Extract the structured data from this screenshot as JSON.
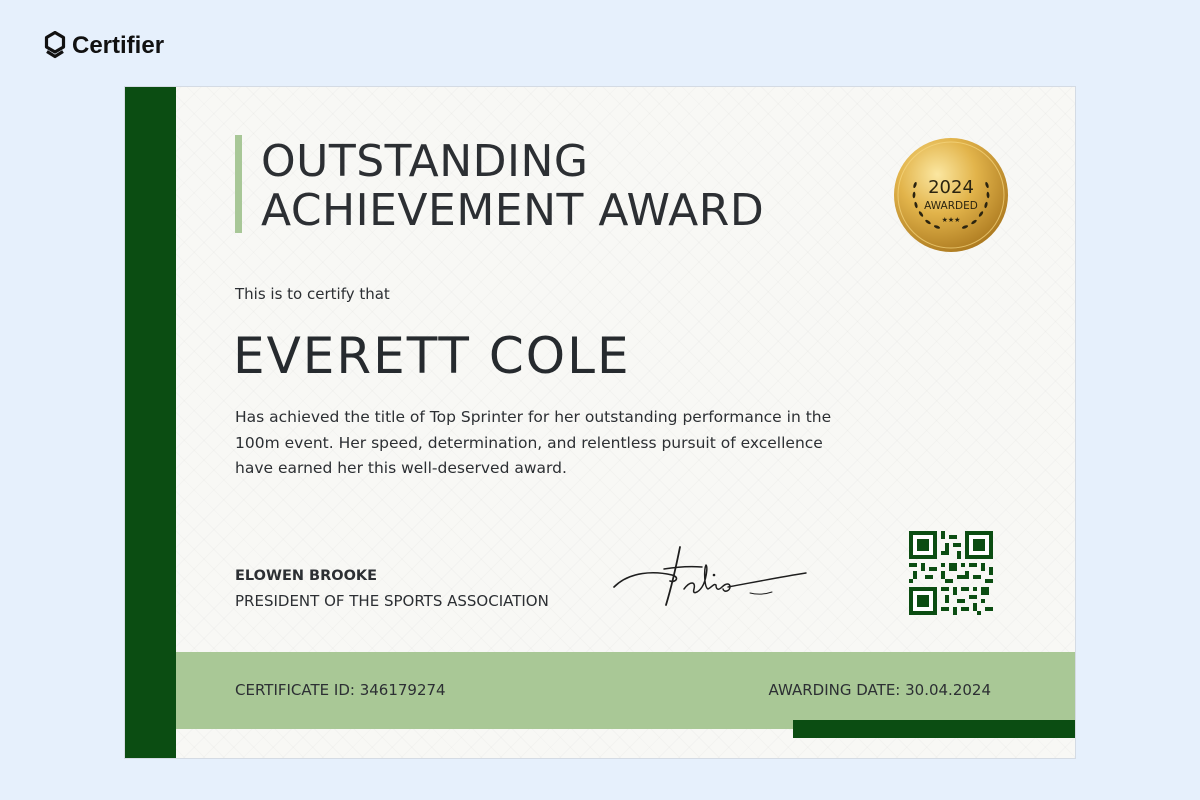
{
  "brand": {
    "logo_icon": "certifier-logo-icon",
    "name": "Certifier"
  },
  "certificate": {
    "title_line1": "OUTSTANDING",
    "title_line2": "ACHIEVEMENT AWARD",
    "seal": {
      "icon": "gold-seal-laurel-icon",
      "year": "2024",
      "label": "AWARDED",
      "stars": "★★★"
    },
    "intro": "This is to certify that",
    "recipient": "EVERETT COLE",
    "description": "Has achieved the title of Top Sprinter for her outstanding performance in the 100m event. Her speed, determination, and relentless pursuit of excellence have earned her this well-deserved award.",
    "signer": {
      "name": "ELOWEN BROOKE",
      "title": "PRESIDENT OF THE SPORTS ASSOCIATION",
      "signature_icon": "handwritten-signature-icon"
    },
    "qr_icon": "qr-code-icon",
    "footer": {
      "certificate_id": "CERTIFICATE ID: 346179274",
      "awarding_date": "AWARDING DATE: 30.04.2024"
    }
  },
  "colors": {
    "page_background": "#e6f0fc",
    "dark_green": "#0b4d12",
    "light_green": "#a9c896",
    "accent_bar": "#a8c797",
    "gold": "#d4a634",
    "text": "#2c2f33"
  }
}
